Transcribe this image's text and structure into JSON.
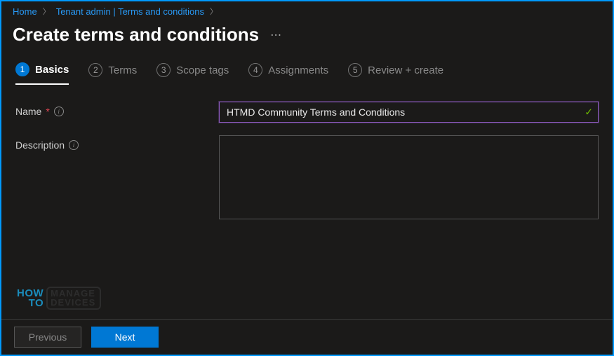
{
  "breadcrumb": {
    "home": "Home",
    "tenant": "Tenant admin | Terms and conditions"
  },
  "page": {
    "title": "Create terms and conditions"
  },
  "tabs": [
    {
      "num": "1",
      "label": "Basics"
    },
    {
      "num": "2",
      "label": "Terms"
    },
    {
      "num": "3",
      "label": "Scope tags"
    },
    {
      "num": "4",
      "label": "Assignments"
    },
    {
      "num": "5",
      "label": "Review + create"
    }
  ],
  "form": {
    "name_label": "Name",
    "name_value": "HTMD Community Terms and Conditions",
    "description_label": "Description",
    "description_value": ""
  },
  "buttons": {
    "previous": "Previous",
    "next": "Next"
  },
  "watermark": {
    "how": "HOW",
    "to": "TO",
    "manage": "MANAGE",
    "devices": "DEVICES"
  }
}
